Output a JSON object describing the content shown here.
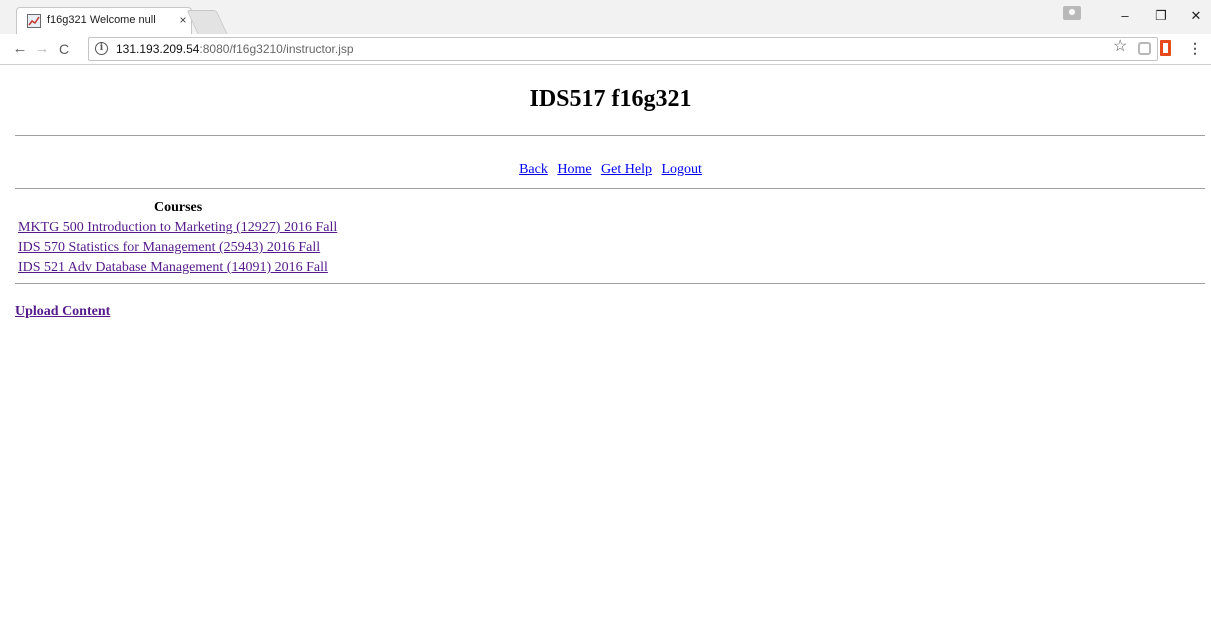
{
  "browser": {
    "tab_title": "f16g321 Welcome null",
    "tab_close": "×",
    "url_host": "131.193.209.54",
    "url_rest": ":8080/f16g3210/instructor.jsp",
    "window_controls": {
      "minimize": "–",
      "maximize": "❐",
      "close": "✕"
    },
    "nav": {
      "back": "←",
      "forward": "→",
      "reload": "C"
    },
    "icons": [
      "page-info-icon",
      "bookmark-star-icon",
      "extension-s-icon",
      "office-icon",
      "chrome-menu-icon"
    ]
  },
  "page": {
    "title": "IDS517 f16g321",
    "nav_links": [
      "Back",
      "Home",
      "Get Help",
      "Logout"
    ],
    "courses_heading": "Courses",
    "courses": [
      "MKTG 500 Introduction to Marketing (12927) 2016 Fall",
      "IDS 570 Statistics for Management (25943) 2016 Fall",
      "IDS 521 Adv Database Management (14091) 2016 Fall"
    ],
    "upload_link": "Upload Content"
  },
  "colors": {
    "link": "#0000ee",
    "visited_link": "#551a8b",
    "chrome_bg": "#f2f2f2"
  }
}
